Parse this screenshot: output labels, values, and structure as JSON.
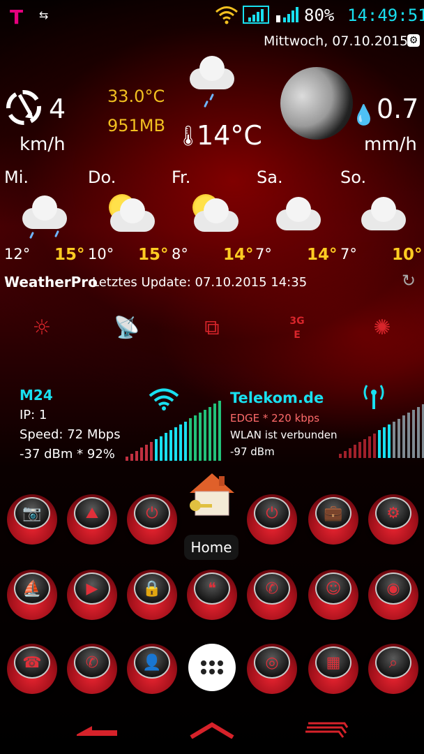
{
  "status_bar": {
    "carrier_logo": "T",
    "battery": "80%",
    "time": "14:49:51",
    "icons": [
      "telekom-logo",
      "data-transfer-icon",
      "wifi-icon",
      "signal-icon",
      "signal-icon",
      "battery-icon"
    ]
  },
  "widget": {
    "date": "Mittwoch, 07.10.2015",
    "wind_speed": "4",
    "wind_unit": "km/h",
    "cpu_temp": "33.0°C",
    "memory": "951MB",
    "current_temp": "14°C",
    "rain_amount": "0.7",
    "rain_unit": "mm/h",
    "forecast": [
      {
        "day": "Mi.",
        "low": "12°",
        "high": "15°"
      },
      {
        "day": "Do.",
        "low": "10°",
        "high": "15°"
      },
      {
        "day": "Fr.",
        "low": "8°",
        "high": "14°"
      },
      {
        "day": "Sa.",
        "low": "7°",
        "high": "14°"
      },
      {
        "day": "So.",
        "low": "7°",
        "high": "10°"
      }
    ],
    "provider": "WeatherPro",
    "update_text": "Letztes Update: 07.10.2015 14:35"
  },
  "toggles": [
    "brightness-icon",
    "satellite-icon",
    "screens-icon",
    "3g-icon",
    "power-saver-icon"
  ],
  "network": {
    "wifi_name": "M24",
    "ip": "IP: 1",
    "speed": "Speed: 72 Mbps",
    "wifi_signal": "-37 dBm * 92%",
    "mobile_name": "Telekom.de",
    "mobile_type": "EDGE * 220 kbps",
    "wlan_status": "WLAN ist verbunden",
    "mobile_signal": "-97 dBm"
  },
  "home_label": "Home",
  "colors": {
    "accent_cyan": "#19e0f0",
    "accent_yellow": "#f2c020",
    "red": "#d8252b"
  },
  "apps_row1": [
    "camera-icon",
    "gallery-icon",
    "power-icon",
    "home-folder-icon",
    "power-icon",
    "briefcase-icon",
    "toolbox-icon"
  ],
  "apps_row2": [
    "sailboat-icon",
    "toolbox-play-icon",
    "lock-icon",
    "quote-chat-icon",
    "phone-chat-icon",
    "smiley-icon",
    "voicemail-icon"
  ],
  "apps_row3": [
    "phone-dialer-icon",
    "phone-icon",
    "contacts-icon",
    "app-drawer-icon",
    "go-sms-icon",
    "calculator-icon",
    "search-icon"
  ]
}
